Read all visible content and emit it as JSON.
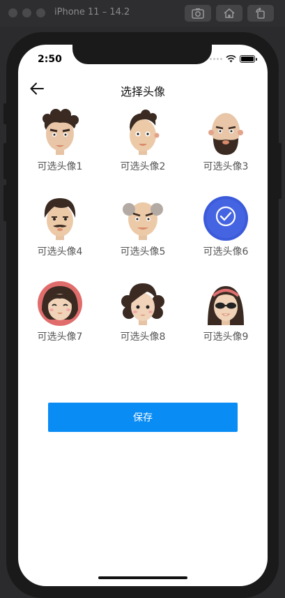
{
  "simulator": {
    "title": "iPhone 11 – 14.2"
  },
  "status": {
    "time": "2:50"
  },
  "nav": {
    "title": "选择头像"
  },
  "avatars": [
    {
      "label": "可选头像1",
      "selected": false
    },
    {
      "label": "可选头像2",
      "selected": false
    },
    {
      "label": "可选头像3",
      "selected": false
    },
    {
      "label": "可选头像4",
      "selected": false
    },
    {
      "label": "可选头像5",
      "selected": false
    },
    {
      "label": "可选头像6",
      "selected": true
    },
    {
      "label": "可选头像7",
      "selected": false
    },
    {
      "label": "可选头像8",
      "selected": false
    },
    {
      "label": "可选头像9",
      "selected": false
    }
  ],
  "save_button": {
    "label": "保存"
  },
  "colors": {
    "accent": "#0A8CF5",
    "selected_overlay": "#3B5BDB"
  }
}
